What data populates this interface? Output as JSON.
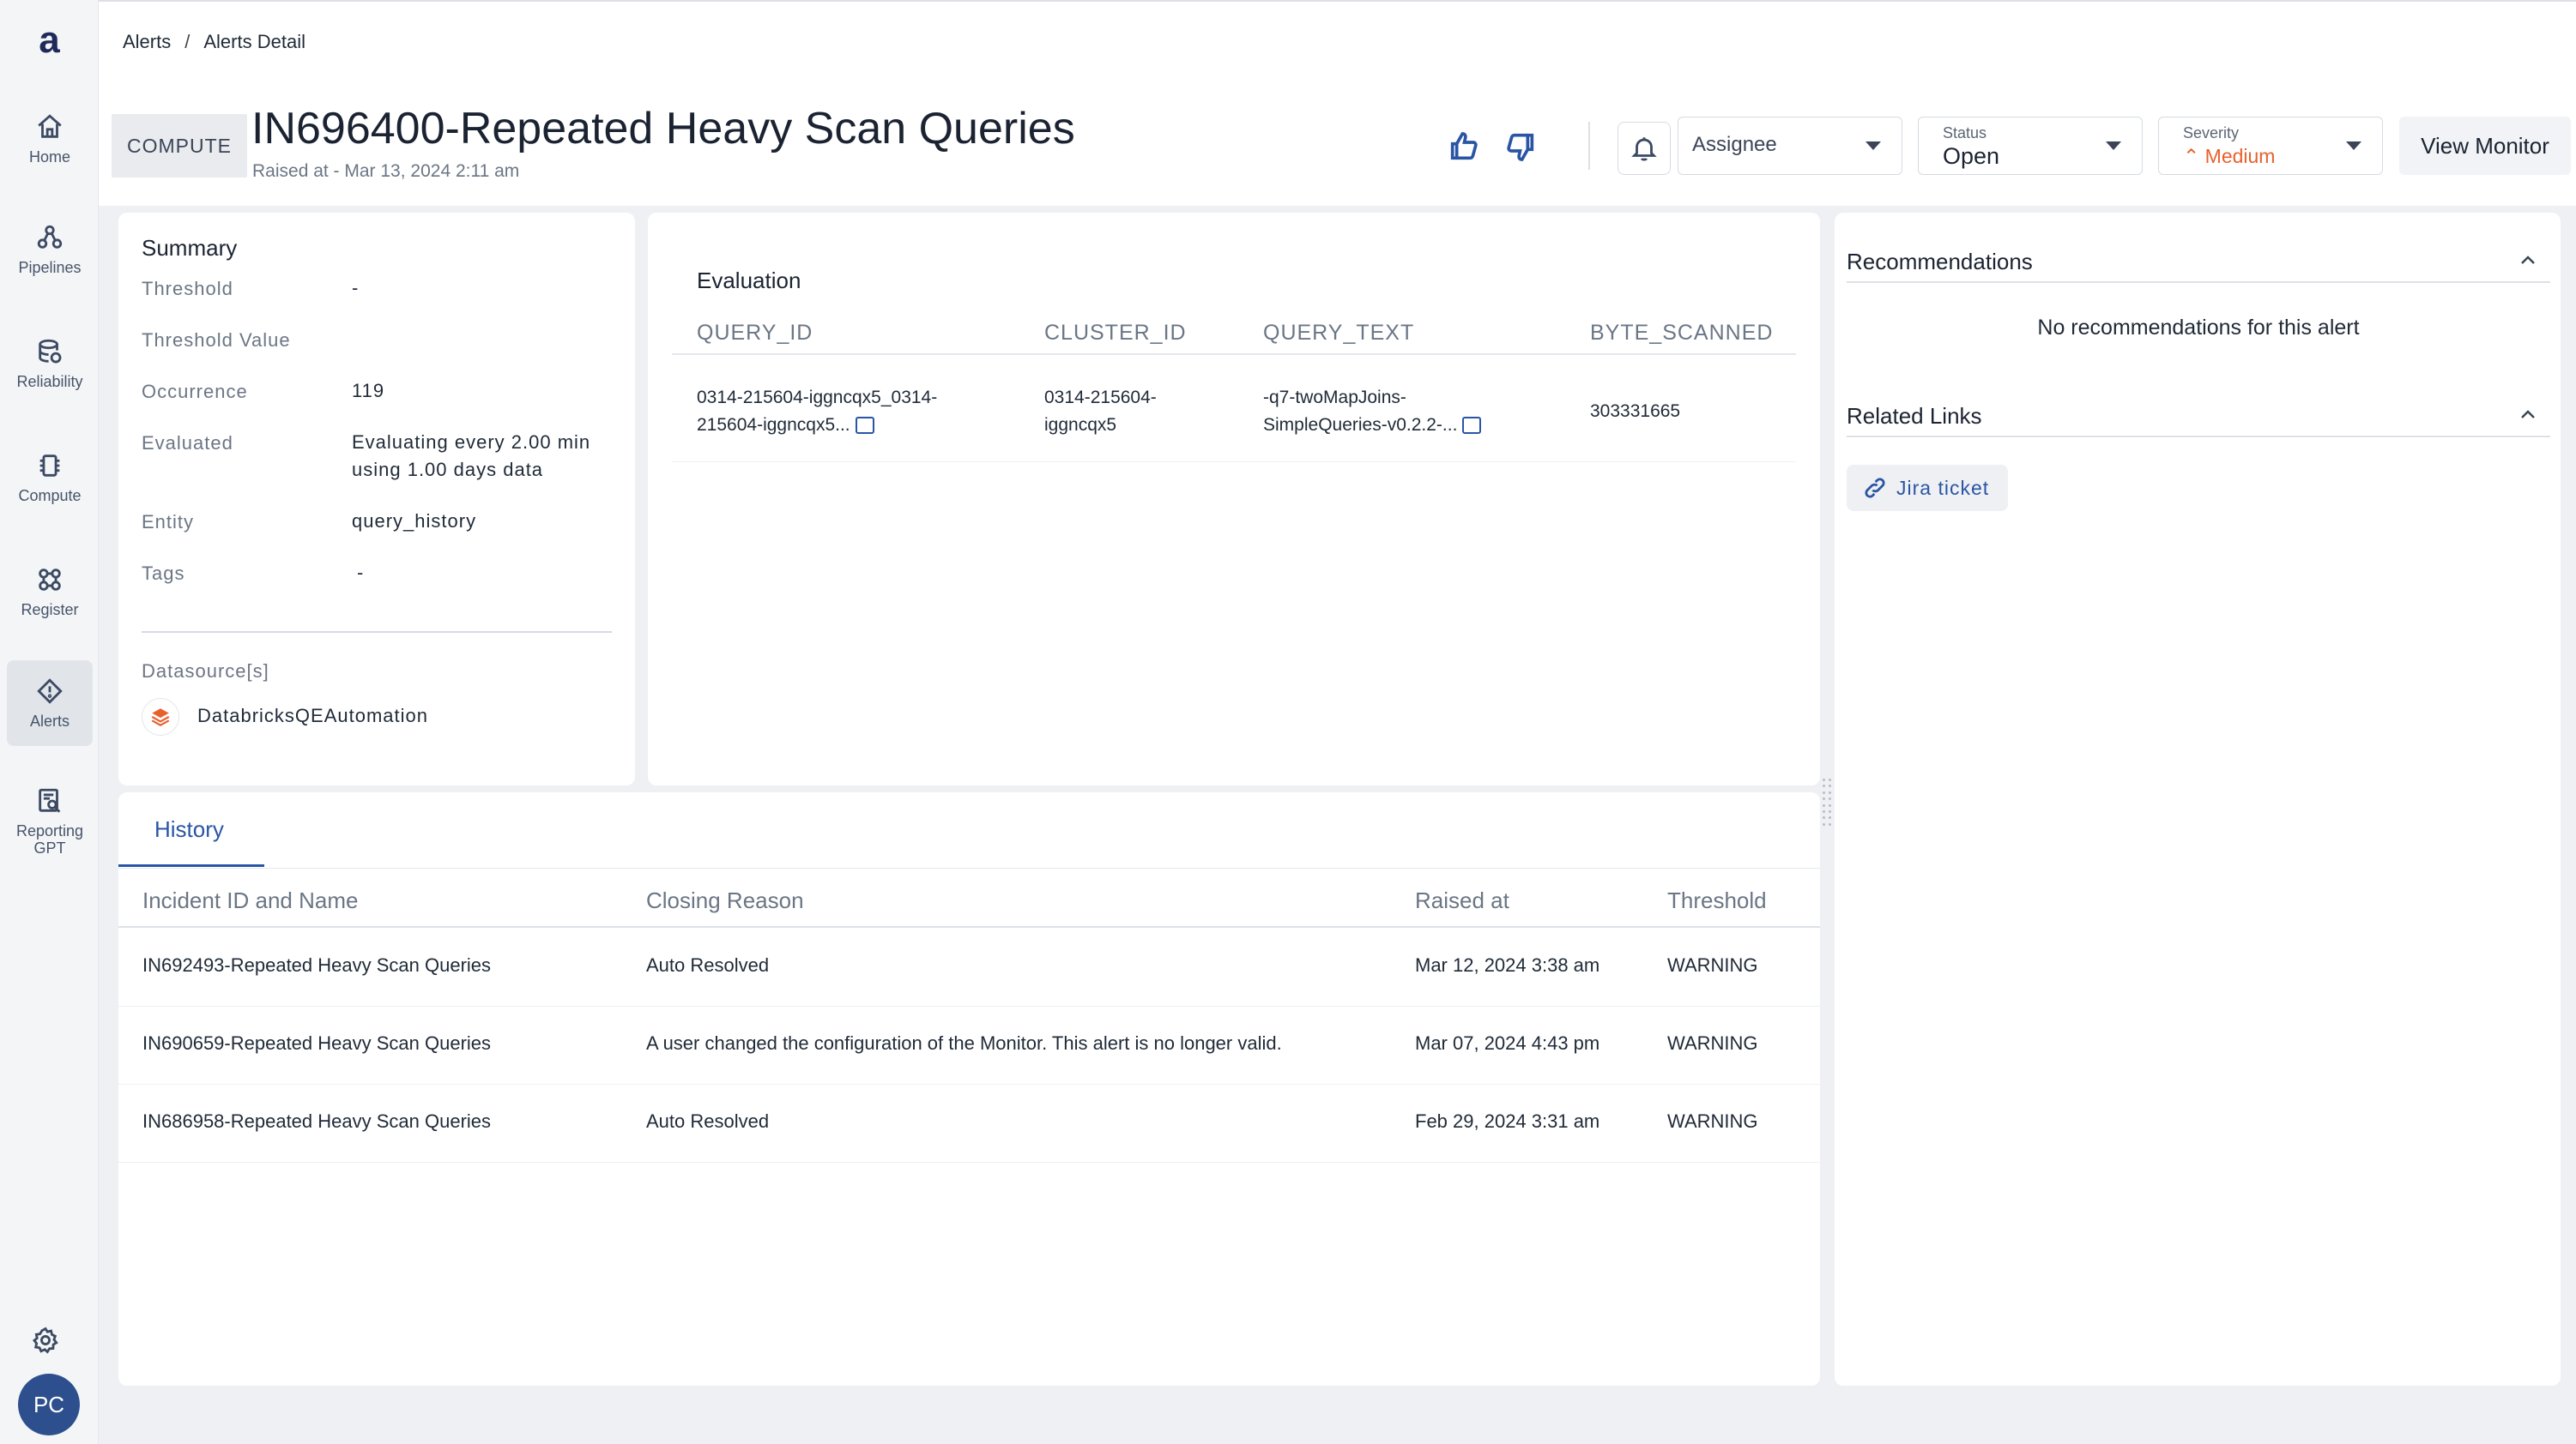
{
  "nav": {
    "logo": "a",
    "items": [
      {
        "label": "Home",
        "icon": "home-icon"
      },
      {
        "label": "Pipelines",
        "icon": "pipelines-icon"
      },
      {
        "label": "Reliability",
        "icon": "database-icon"
      },
      {
        "label": "Compute",
        "icon": "chip-icon"
      },
      {
        "label": "Register",
        "icon": "register-icon"
      },
      {
        "label": "Alerts",
        "icon": "alert-icon",
        "active": true
      },
      {
        "label": "Reporting GPT",
        "icon": "report-search-icon"
      }
    ],
    "settings_icon": "gear-icon",
    "avatar_initials": "PC"
  },
  "breadcrumb": {
    "root": "Alerts",
    "sep": "/",
    "current": "Alerts Detail"
  },
  "header": {
    "chip": "COMPUTE",
    "title": "IN696400-Repeated Heavy Scan Queries",
    "raised": "Raised at - Mar 13, 2024 2:11 am",
    "assignee_placeholder": "Assignee",
    "status_caption": "Status",
    "status_value": "Open",
    "severity_caption": "Severity",
    "severity_value": "⌃ Medium",
    "view_monitor": "View Monitor"
  },
  "summary": {
    "title": "Summary",
    "rows": [
      {
        "label": "Threshold",
        "value": "-"
      },
      {
        "label": "Threshold Value",
        "value": ""
      },
      {
        "label": "Occurrence",
        "value": "119"
      },
      {
        "label": "Evaluated",
        "value": "Evaluating every 2.00 min using 1.00 days data"
      },
      {
        "label": "Entity",
        "value": "query_history"
      },
      {
        "label": "Tags",
        "value": "-"
      }
    ],
    "datasource_title": "Datasource[s]",
    "datasource_name": "DatabricksQEAutomation"
  },
  "evaluation": {
    "title": "Evaluation",
    "columns": [
      "QUERY_ID",
      "CLUSTER_ID",
      "QUERY_TEXT",
      "BYTE_SCANNED"
    ],
    "row": {
      "query_id_1": "0314-215604-iggncqx5_0314-",
      "query_id_2": "215604-iggncqx5...",
      "cluster_id_1": "0314-215604-",
      "cluster_id_2": "iggncqx5",
      "query_text_1": "-q7-twoMapJoins-",
      "query_text_2": "SimpleQueries-v0.2.2-...",
      "byte_scanned": "303331665"
    }
  },
  "history": {
    "tab": "History",
    "columns": [
      "Incident ID and Name",
      "Closing Reason",
      "Raised at",
      "Threshold"
    ],
    "rows": [
      {
        "name": "IN692493-Repeated Heavy Scan Queries",
        "reason": "Auto Resolved",
        "raised": "Mar 12, 2024 3:38 am",
        "threshold": "WARNING"
      },
      {
        "name": "IN690659-Repeated Heavy Scan Queries",
        "reason": "A user changed the configuration of the Monitor. This alert is no longer valid.",
        "raised": "Mar 07, 2024 4:43 pm",
        "threshold": "WARNING"
      },
      {
        "name": "IN686958-Repeated Heavy Scan Queries",
        "reason": "Auto Resolved",
        "raised": "Feb 29, 2024 3:31 am",
        "threshold": "WARNING"
      }
    ]
  },
  "right_panel": {
    "recommendations_title": "Recommendations",
    "no_recommendations": "No recommendations for this alert",
    "related_links_title": "Related Links",
    "jira_label": "Jira ticket"
  },
  "colors": {
    "accent": "#2a55a4",
    "severity_medium": "#e8612c",
    "avatar": "#2d4f8e"
  }
}
